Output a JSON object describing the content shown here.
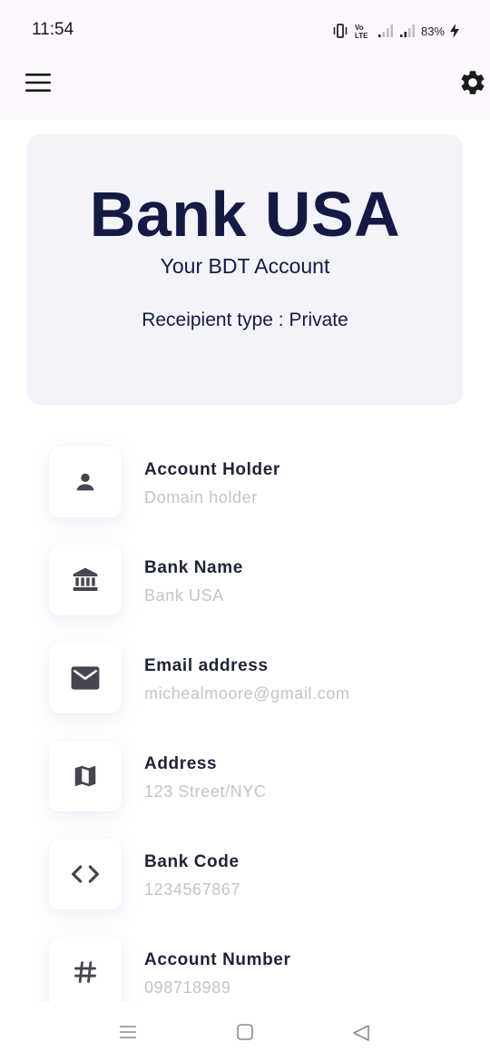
{
  "status_bar": {
    "time": "11:54",
    "network_label": "VoLTE",
    "battery_percent": "83%"
  },
  "app_bar": {
    "menu_icon": "hamburger-menu-icon",
    "settings_icon": "gear-icon"
  },
  "hero": {
    "title": "Bank USA",
    "subtitle": "Your BDT Account",
    "recipient_type": "Receipient type : Private"
  },
  "details": [
    {
      "icon": "person-icon",
      "label": "Account Holder",
      "value": "Domain holder"
    },
    {
      "icon": "bank-icon",
      "label": "Bank Name",
      "value": "Bank USA"
    },
    {
      "icon": "email-icon",
      "label": "Email address",
      "value": "michealmoore@gmail.com"
    },
    {
      "icon": "map-icon",
      "label": "Address",
      "value": "123 Street/NYC"
    },
    {
      "icon": "code-icon",
      "label": "Bank Code",
      "value": "1234567867"
    },
    {
      "icon": "hash-icon",
      "label": "Account Number",
      "value": "098718989"
    }
  ],
  "colors": {
    "primary_text": "#141a44",
    "card_background": "#f3f4f9",
    "muted_text": "#c3c4c9",
    "icon_color": "#444551"
  }
}
